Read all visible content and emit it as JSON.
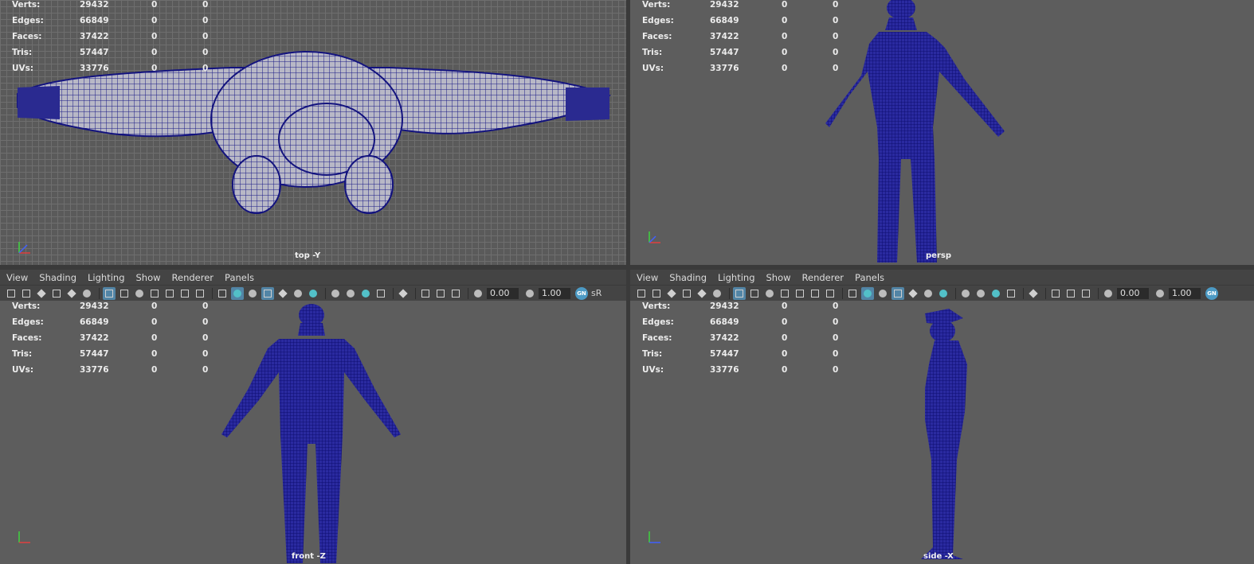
{
  "hud_labels": {
    "verts": "Verts:",
    "edges": "Edges:",
    "faces": "Faces:",
    "tris": "Tris:",
    "uvs": "UVs:"
  },
  "hud_values": {
    "verts": [
      "29432",
      "0",
      "0"
    ],
    "edges": [
      "66849",
      "0",
      "0"
    ],
    "faces": [
      "37422",
      "0",
      "0"
    ],
    "tris": [
      "57447",
      "0",
      "0"
    ],
    "uvs": [
      "33776",
      "0",
      "0"
    ]
  },
  "cameras": {
    "top": "top -Y",
    "persp": "persp",
    "front": "front -Z",
    "side": "side -X"
  },
  "menu": [
    "View",
    "Shading",
    "Lighting",
    "Show",
    "Renderer",
    "Panels"
  ],
  "toolbar": {
    "exposure": "0.00",
    "gamma": "1.00",
    "gn_badge": "GN",
    "color_space": "sR"
  },
  "colors": {
    "wireframe": "#13137e",
    "viewport_bg": "#5d5d5d",
    "highlight": "#5285a6"
  }
}
